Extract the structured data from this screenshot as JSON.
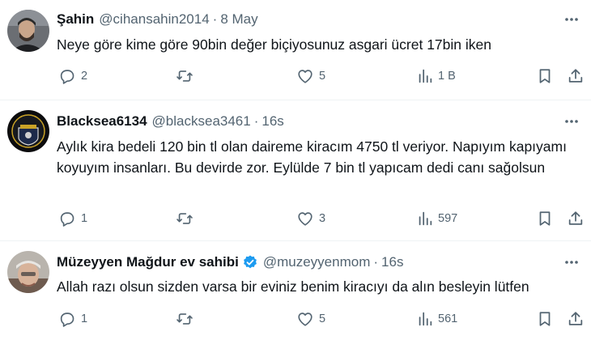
{
  "tweets": [
    {
      "name": "Şahin",
      "handle": "@cihansahin2014",
      "separator": "·",
      "time": "8 May",
      "text": "Neye göre kime göre 90bin değer biçiyosunuz  asgari ücret 17bin iken",
      "replies": "2",
      "retweets": "",
      "likes": "5",
      "views": "1 B",
      "verified": false
    },
    {
      "name": "Blacksea6134",
      "handle": "@blacksea3461",
      "separator": "·",
      "time": "16s",
      "text": "Aylık kira bedeli 120 bin tl olan daireme kiracım 4750 tl veriyor. Napıyım kapıyamı koyuyım insanları. Bu devirde zor. Eylülde 7 bin tl yapıcam dedi canı sağolsun",
      "replies": "1",
      "retweets": "",
      "likes": "3",
      "views": "597",
      "verified": false
    },
    {
      "name": "Müzeyyen Mağdur ev sahibi",
      "handle": "@muzeyyenmom",
      "separator": "·",
      "time": "16s",
      "text": "Allah razı olsun sizden varsa bir eviniz benim kiracıyı da alın besleyin lütfen",
      "replies": "1",
      "retweets": "",
      "likes": "5",
      "views": "561",
      "verified": true
    }
  ],
  "colors": {
    "text": "#0f1419",
    "secondary": "#536471",
    "verified": "#1d9bf0",
    "divider": "#eff3f4"
  },
  "icons": [
    "reply-icon",
    "retweet-icon",
    "like-icon",
    "views-icon",
    "bookmark-icon",
    "share-icon",
    "more-icon",
    "verified-badge-icon"
  ]
}
